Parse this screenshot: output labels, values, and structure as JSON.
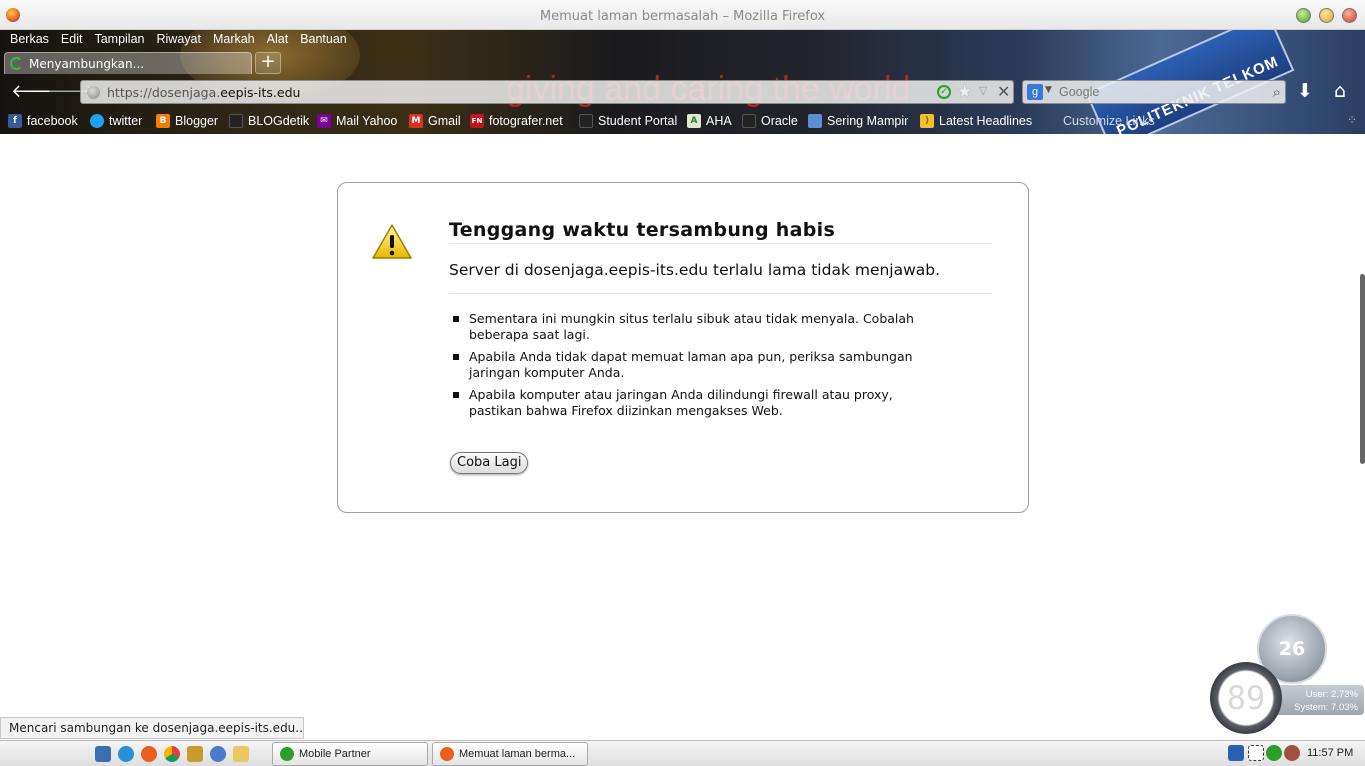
{
  "window": {
    "title": "Memuat laman bermasalah – Mozilla Firefox"
  },
  "menu": [
    "Berkas",
    "Edit",
    "Tampilan",
    "Riwayat",
    "Markah",
    "Alat",
    "Bantuan"
  ],
  "tab": {
    "label": "Menyambungkan...",
    "new_tab_glyph": "+"
  },
  "urlbar": {
    "prefix": "https://",
    "sub": "dosenjaga.",
    "domain": "eepis-its.edu"
  },
  "search": {
    "placeholder": "Google"
  },
  "theme": {
    "slogan": "giving and caring the world",
    "sign": "POLITEKNIK TELKOM"
  },
  "bookmarks": [
    {
      "label": "facebook",
      "icon": "facebook-icon",
      "color": "#3b5998"
    },
    {
      "label": "twitter",
      "icon": "twitter-icon",
      "color": "#1da1f2"
    },
    {
      "label": "Blogger",
      "icon": "blogger-icon",
      "color": "#f57d00"
    },
    {
      "label": "BLOGdetik",
      "icon": "page-icon",
      "color": "#222222"
    },
    {
      "label": "Mail Yahoo",
      "icon": "yahoo-mail-icon",
      "color": "#7b0099"
    },
    {
      "label": "Gmail",
      "icon": "gmail-icon",
      "color": "#d93025"
    },
    {
      "label": "fotografer.net",
      "icon": "fn-icon",
      "color": "#c0141e"
    },
    {
      "label": "Student Portal",
      "icon": "page-icon",
      "color": "#222222"
    },
    {
      "label": "AHA",
      "icon": "aha-icon",
      "color": "#dfe8d0"
    },
    {
      "label": "Oracle",
      "icon": "page-icon",
      "color": "#222222"
    },
    {
      "label": "Sering Mampir",
      "icon": "most-visited-icon",
      "color": "#5a8fd8"
    },
    {
      "label": "Latest Headlines",
      "icon": "rss-folder-icon",
      "color": "#f0c030"
    },
    {
      "label": "Customize Links",
      "icon": "",
      "color": ""
    }
  ],
  "error": {
    "title": "Tenggang waktu tersambung habis",
    "short": "Server di dosenjaga.eepis-its.edu terlalu lama tidak menjawab.",
    "items": [
      "Sementara ini mungkin situs terlalu sibuk atau tidak menyala. Cobalah beberapa saat lagi.",
      "Apabila Anda tidak dapat memuat laman apa pun, periksa sambungan jaringan komputer Anda.",
      "Apabila komputer atau jaringan Anda dilindungi firewall atau proxy, pastikan bahwa Firefox diizinkan mengakses Web."
    ],
    "retry_label": "Coba Lagi"
  },
  "status_text": "Mencari sambungan ke dosenjaga.eepis-its.edu...",
  "gadget": {
    "dial_value": "26",
    "digit_value": "89",
    "user": "User: 2.73%",
    "system": "System: 7.03%"
  },
  "taskbar": {
    "tasks": [
      {
        "label": "Mobile Partner",
        "color": "#2aa02a"
      },
      {
        "label": "Memuat laman berma...",
        "color": "#e8601c"
      }
    ],
    "clock": "11:57 PM"
  }
}
